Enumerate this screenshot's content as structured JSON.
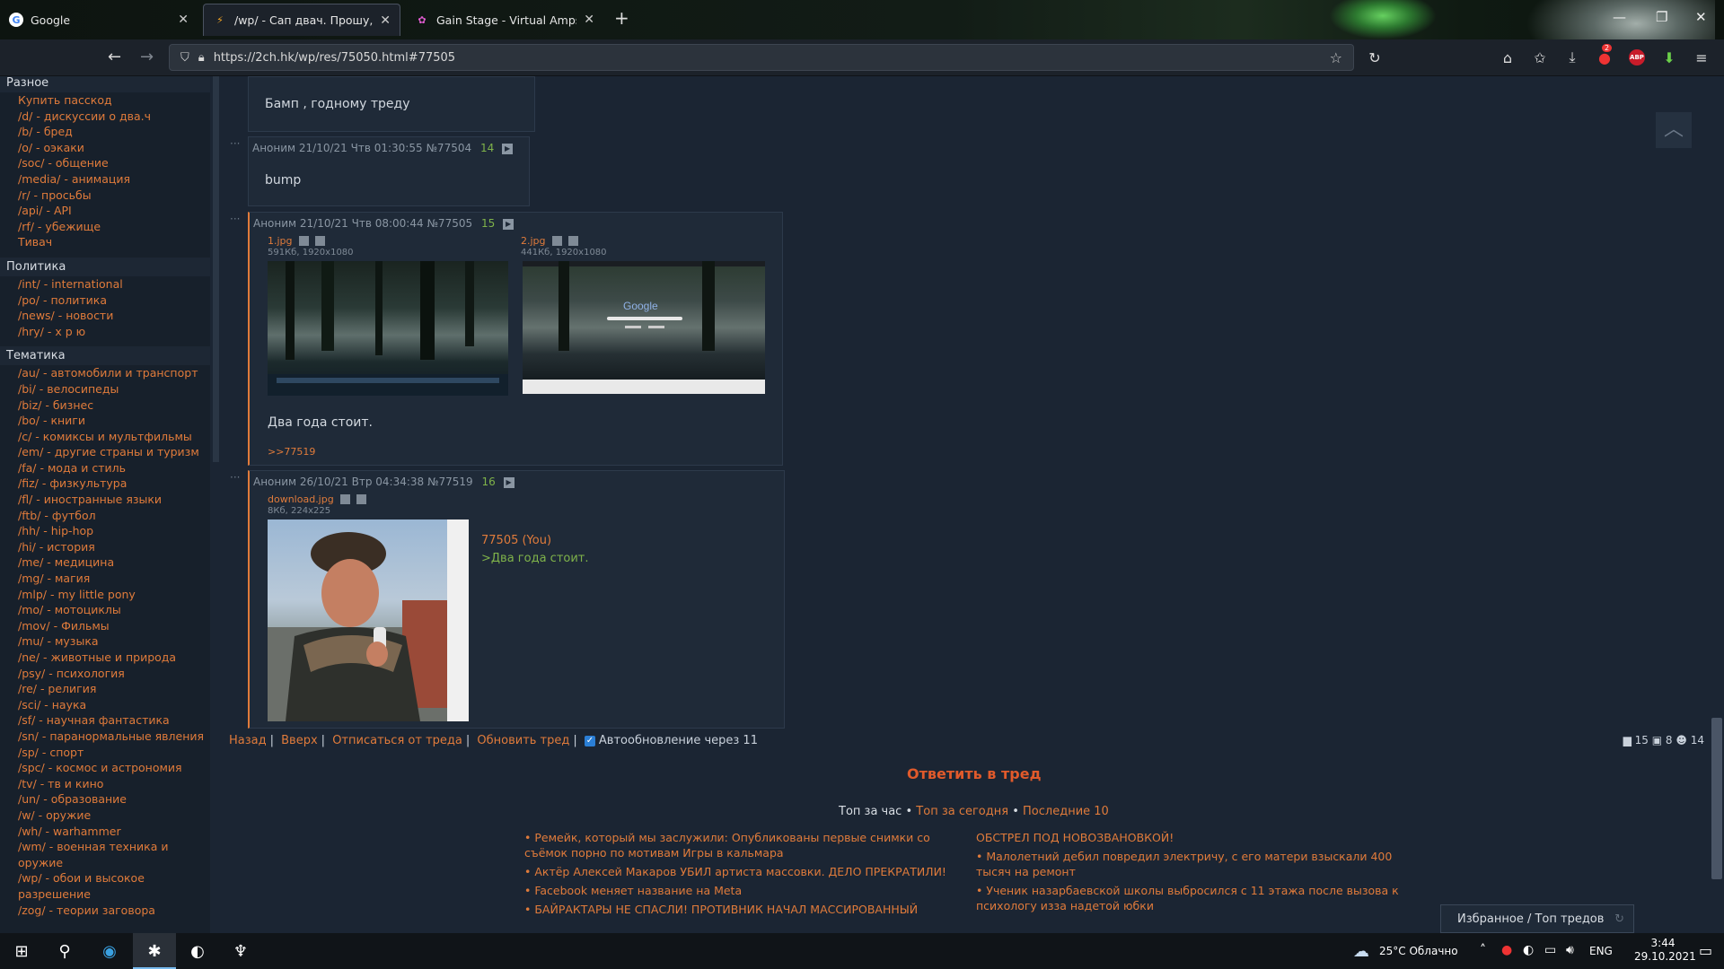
{
  "browser": {
    "tabs": [
      {
        "label": "Google",
        "icon": "G"
      },
      {
        "label": "/wp/ - Сап двач. Прошу, наки",
        "icon": "⚡"
      },
      {
        "label": "Gain Stage - Virtual Amps Bund",
        "icon": "✿"
      }
    ],
    "new_tab": "+",
    "url": "https://2ch.hk/wp/res/75050.html#77505",
    "downloads_badge": "2"
  },
  "sidebar": {
    "groups": [
      {
        "title": "Разное",
        "items": [
          "Купить пасскод",
          "/d/ - дискуссии о два.ч",
          "/b/ - бред",
          "/o/ - оэкаки",
          "/soc/ - общение",
          "/media/ - анимация",
          "/r/ - просьбы",
          "/api/ - API",
          "/rf/ - убежище",
          "Тивач"
        ]
      },
      {
        "title": "Политика",
        "items": [
          "/int/ - international",
          "/po/ - политика",
          "/news/ - новости",
          "/hry/ - х р ю"
        ]
      },
      {
        "title": "Тематика",
        "items": [
          "/au/ - автомобили и транспорт",
          "/bi/ - велосипеды",
          "/biz/ - бизнес",
          "/bo/ - книги",
          "/c/ - комиксы и мультфильмы",
          "/em/ - другие страны и туризм",
          "/fa/ - мода и стиль",
          "/fiz/ - физкультура",
          "/fl/ - иностранные языки",
          "/ftb/ - футбол",
          "/hh/ - hip-hop",
          "/hi/ - история",
          "/me/ - медицина",
          "/mg/ - магия",
          "/mlp/ - my little pony",
          "/mo/ - мотоциклы",
          "/mov/ - Фильмы",
          "/mu/ - музыка",
          "/ne/ - животные и природа",
          "/psy/ - психология",
          "/re/ - религия",
          "/sci/ - наука",
          "/sf/ - научная фантастика",
          "/sn/ - паранормальные явления",
          "/sp/ - спорт",
          "/spc/ - космос и астрономия",
          "/tv/ - тв и кино",
          "/un/ - образование",
          "/w/ - оружие",
          "/wh/ - warhammer",
          "/wm/ - военная техника и",
          "оружие",
          "/wp/ - обои и высокое",
          "разрешение",
          "/zog/ - теории заговора"
        ]
      }
    ]
  },
  "posts": {
    "p0": {
      "text": "Бамп , годному треду"
    },
    "p1": {
      "header": "Аноним 21/10/21 Чтв 01:30:55",
      "num": "№77504",
      "count": "14",
      "text": "bump"
    },
    "p2": {
      "header": "Аноним 21/10/21 Чтв 08:00:44",
      "num": "№77505",
      "count": "15",
      "files": [
        {
          "name": "1.jpg",
          "meta": "591Кб, 1920x1080"
        },
        {
          "name": "2.jpg",
          "meta": "441Кб, 1920x1080"
        }
      ],
      "text": "Два года стоит.",
      "reply": ">>77519"
    },
    "p3": {
      "header": "Аноним 26/10/21 Втр 04:34:38",
      "num": "№77519",
      "count": "16",
      "file": {
        "name": "download.jpg",
        "meta": "8Кб, 224x225"
      },
      "quote_link": "77505 (You)",
      "greentext": ">Два года стоит."
    }
  },
  "controls": {
    "back": "Назад",
    "top": "Вверх",
    "unsub": "Отписаться от треда",
    "refresh": "Обновить тред",
    "autoupdate": "Автообновление через 11",
    "stats": {
      "posts": "15",
      "files": "8",
      "users": "14"
    }
  },
  "reply_button": "Ответить в тред",
  "tops": {
    "hour": "Топ за час",
    "today": "Топ за сегодня",
    "last": "Последние 10",
    "bullet": "•"
  },
  "news": {
    "left": [
      "• Ремейк, который мы заслужили: Опубликованы первые снимки со",
      "съёмок порно по мотивам Игры в кальмара",
      "• Актёр Алексей Макаров УБИЛ артиста массовки. ДЕЛО ПРЕКРАТИЛИ!",
      "• Facebook меняет название на Meta",
      "• БАЙРАКТАРЫ НЕ СПАСЛИ! ПРОТИВНИК НАЧАЛ МАССИРОВАННЫЙ"
    ],
    "right": [
      "ОБСТРЕЛ ПОД НОВОЗВАНОВКОЙ!",
      "• Малолетний дебил повредил электричу, с его матери взыскали 400",
      "тысяч на ремонт",
      "• Ученик назарбаевской школы выбросился с 11 этажа после вызова к",
      "психологу изза надетой юбки"
    ]
  },
  "favorites": "Избранное / Топ тредов",
  "taskbar": {
    "weather": "25°C  Облачно",
    "lang": "ENG",
    "time": "3:44",
    "date": "29.10.2021"
  },
  "colors": {
    "accent": "#e07b3b",
    "green": "#7fb34a",
    "bg": "#1b2533"
  }
}
